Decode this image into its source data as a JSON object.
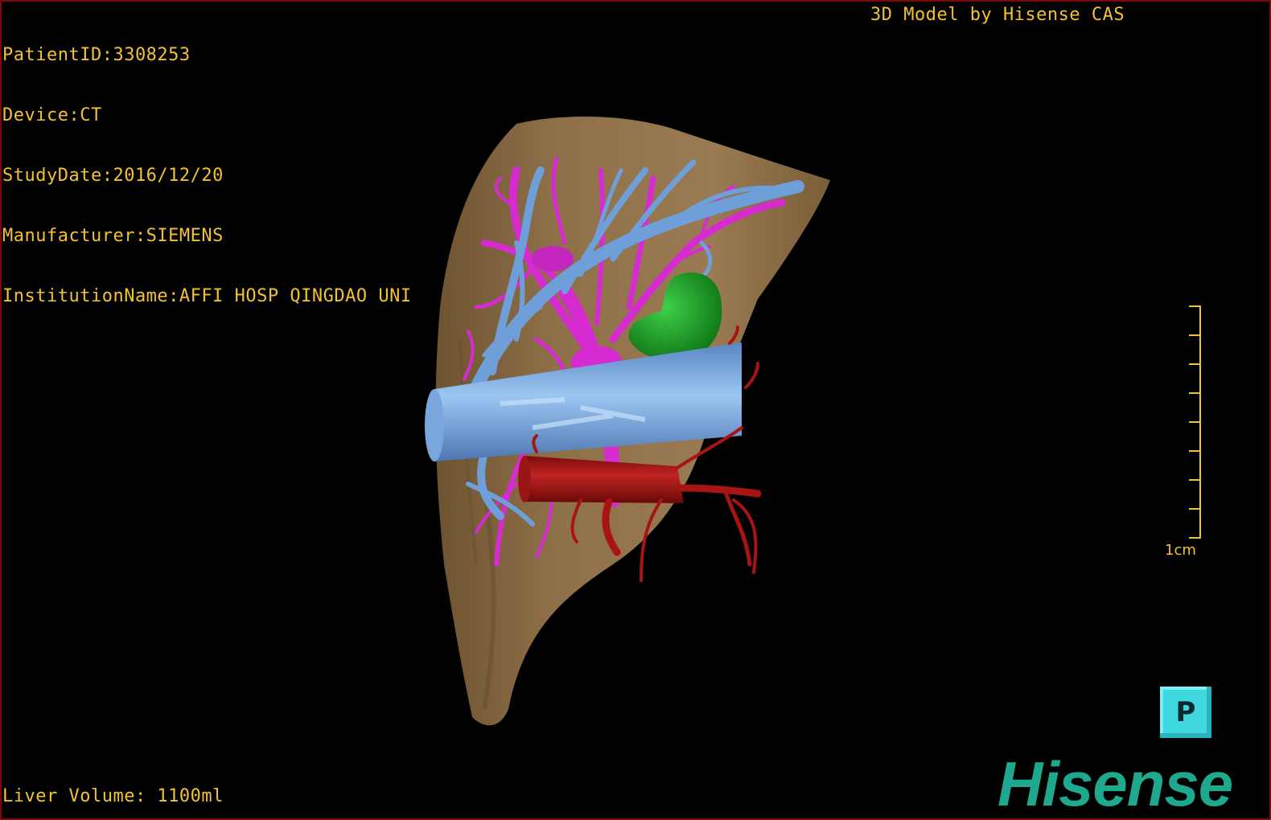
{
  "header": {
    "patient_id": "PatientID:3308253",
    "device": "Device:CT",
    "study_date": "StudyDate:2016/12/20",
    "manufacturer": "Manufacturer:SIEMENS",
    "institution": "InstitutionName:AFFI HOSP QINGDAO UNI",
    "credit": "3D Model by Hisense CAS"
  },
  "footer": {
    "liver_volume": "Liver Volume: 1100ml"
  },
  "scale_bar": {
    "label": "1cm"
  },
  "orientation_cube": {
    "glyph": "P"
  },
  "brand": {
    "logo_text": "Hisense"
  },
  "colors": {
    "overlay_text": "#f2c230",
    "liver": "#8a6c44",
    "hepatic_vein": "#6e9fd8",
    "portal_vein": "#d62bd0",
    "artery": "#a81414",
    "tumor": "#17a51f",
    "brand": "#1ea98e",
    "orientation_cube": "#3fd8e0"
  },
  "icons": {
    "orientation": "orientation-cube-icon",
    "ruler": "ruler-icon"
  }
}
